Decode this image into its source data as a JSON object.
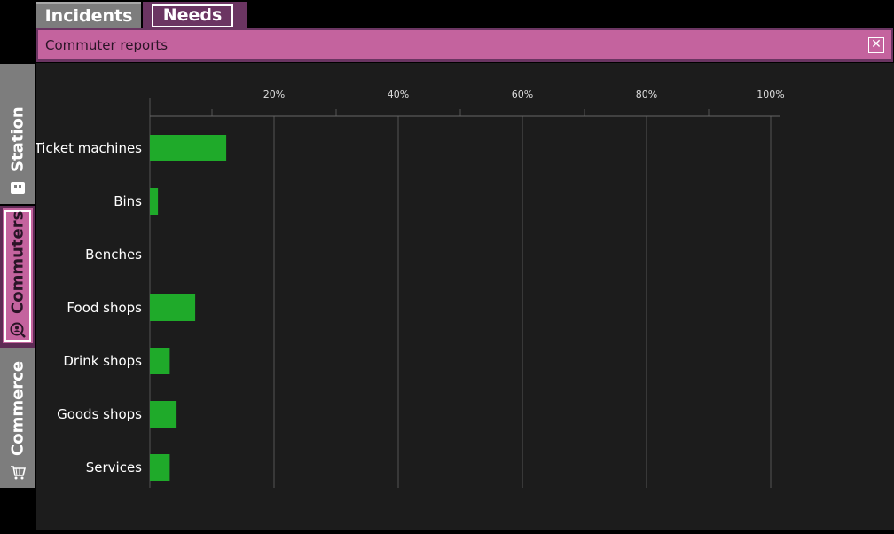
{
  "tabs": {
    "incidents": "Incidents",
    "needs": "Needs"
  },
  "header": {
    "title": "Commuter reports",
    "close_symbol": "✕"
  },
  "side_tabs": [
    {
      "label": "Station",
      "icon": "station-icon"
    },
    {
      "label": "Commuters",
      "icon": "commuter-search-icon",
      "active": true
    },
    {
      "label": "Commerce",
      "icon": "shopping-cart-icon"
    }
  ],
  "colors": {
    "accent": "#c4639e",
    "accent_dark": "#6b3562",
    "bar": "#1faa2a",
    "panel": "#1c1c1c",
    "tab_inactive": "#7d7d7d"
  },
  "chart_data": {
    "type": "bar",
    "orientation": "horizontal",
    "categories": [
      "Ticket machines",
      "Bins",
      "Benches",
      "Food shops",
      "Drink shops",
      "Goods shops",
      "Services"
    ],
    "values": [
      12.3,
      1.3,
      0,
      7.3,
      3.2,
      4.3,
      3.2
    ],
    "x_ticks": [
      "20%",
      "40%",
      "60%",
      "80%",
      "100%"
    ],
    "xlim": [
      0,
      100
    ],
    "grid": true
  }
}
